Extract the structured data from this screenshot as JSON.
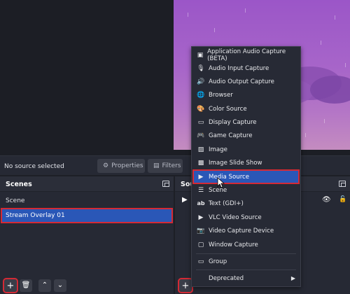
{
  "context_bar": {
    "status": "No source selected",
    "properties_label": "Properties",
    "filters_label": "Filters"
  },
  "scenes_dock": {
    "title": "Scenes",
    "items": [
      {
        "label": "Scene",
        "selected": false
      },
      {
        "label": "Stream Overlay 01",
        "selected": true
      }
    ]
  },
  "sources_dock": {
    "title": "Sou"
  },
  "add_source_menu": {
    "items": [
      {
        "label": "Application Audio Capture (BETA)",
        "icon": "app-audio-icon"
      },
      {
        "label": "Audio Input Capture",
        "icon": "microphone-icon"
      },
      {
        "label": "Audio Output Capture",
        "icon": "speaker-icon"
      },
      {
        "label": "Browser",
        "icon": "globe-icon"
      },
      {
        "label": "Color Source",
        "icon": "palette-icon"
      },
      {
        "label": "Display Capture",
        "icon": "monitor-icon"
      },
      {
        "label": "Game Capture",
        "icon": "gamepad-icon"
      },
      {
        "label": "Image",
        "icon": "image-icon"
      },
      {
        "label": "Image Slide Show",
        "icon": "slideshow-icon"
      },
      {
        "label": "Media Source",
        "icon": "play-icon",
        "active": true
      },
      {
        "label": "Scene",
        "icon": "list-icon"
      },
      {
        "label": "Text (GDI+)",
        "icon": "text-icon"
      },
      {
        "label": "VLC Video Source",
        "icon": "play-icon"
      },
      {
        "label": "Video Capture Device",
        "icon": "camera-icon"
      },
      {
        "label": "Window Capture",
        "icon": "window-icon"
      },
      {
        "label": "Group",
        "icon": "folder-icon"
      },
      {
        "label": "Deprecated",
        "icon": "",
        "submenu": true
      }
    ]
  },
  "colors": {
    "accent": "#2a57b7",
    "highlight_ring": "#d42a35",
    "panel": "#262934"
  }
}
